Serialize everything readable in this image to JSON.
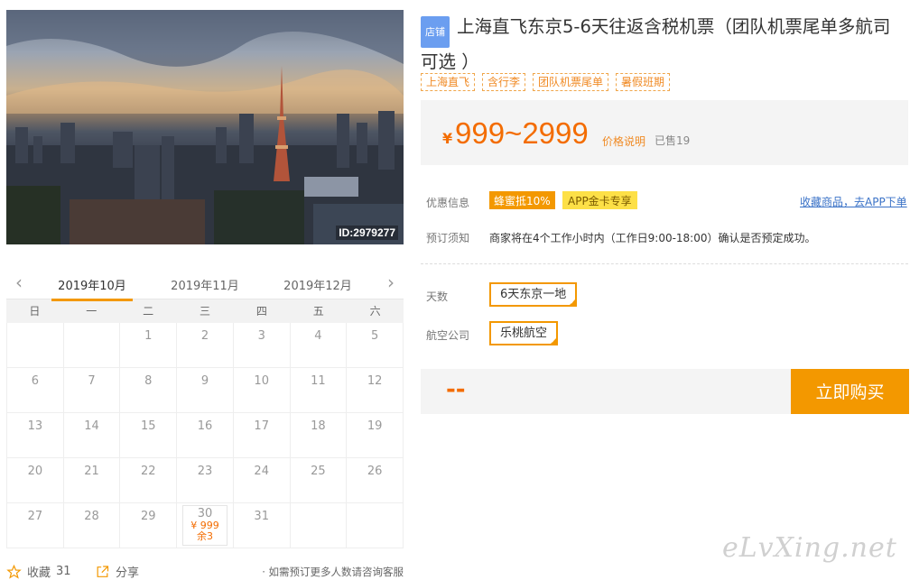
{
  "photo": {
    "id_label": "ID:2979277"
  },
  "calendar": {
    "months": [
      "2019年10月",
      "2019年11月",
      "2019年12月"
    ],
    "active_month": 0,
    "weekdays": [
      "日",
      "一",
      "二",
      "三",
      "四",
      "五",
      "六"
    ],
    "weeks": [
      [
        {
          "d": ""
        },
        {
          "d": ""
        },
        {
          "d": "1"
        },
        {
          "d": "2"
        },
        {
          "d": "3"
        },
        {
          "d": "4"
        },
        {
          "d": "5"
        }
      ],
      [
        {
          "d": "6"
        },
        {
          "d": "7"
        },
        {
          "d": "8"
        },
        {
          "d": "9"
        },
        {
          "d": "10"
        },
        {
          "d": "11"
        },
        {
          "d": "12"
        }
      ],
      [
        {
          "d": "13"
        },
        {
          "d": "14"
        },
        {
          "d": "15"
        },
        {
          "d": "16"
        },
        {
          "d": "17"
        },
        {
          "d": "18"
        },
        {
          "d": "19"
        }
      ],
      [
        {
          "d": "20"
        },
        {
          "d": "21"
        },
        {
          "d": "22"
        },
        {
          "d": "23"
        },
        {
          "d": "24"
        },
        {
          "d": "25"
        },
        {
          "d": "26"
        }
      ],
      [
        {
          "d": "27"
        },
        {
          "d": "28"
        },
        {
          "d": "29"
        },
        {
          "d": "30",
          "price": "¥ 999",
          "stock": "余3"
        },
        {
          "d": "31"
        },
        {
          "d": ""
        },
        {
          "d": ""
        }
      ]
    ]
  },
  "footer": {
    "favorite_label": "收藏",
    "favorite_count": "31",
    "share_label": "分享",
    "note": "· 如需预订更多人数请咨询客服"
  },
  "product": {
    "badge": "店铺",
    "title": "上海直飞东京5-6天往返含税机票（团队机票尾单多航司可选 ）",
    "tags": [
      "上海直飞",
      "含行李",
      "团队机票尾单",
      "暑假班期"
    ],
    "price": {
      "currency": "¥",
      "amount": "999~2999",
      "explain": "价格说明",
      "sold": "已售19"
    },
    "promo": {
      "label": "优惠信息",
      "badge1": "蜂蜜抵10%",
      "badge2": "APP金卡专享",
      "link": "收藏商品，去APP下单"
    },
    "notice": {
      "label": "预订须知",
      "text": "商家将在4个工作小时内（工作日9:00-18:00）确认是否预定成功。"
    },
    "options": {
      "days_label": "天数",
      "days_value": "6天东京一地",
      "airline_label": "航空公司",
      "airline_value": "乐桃航空"
    },
    "buy": {
      "total": "--",
      "button": "立即购买"
    }
  },
  "watermark": "eLvXing.net",
  "colors": {
    "accent": "#f39800",
    "price": "#f36c00",
    "link": "#3a72c7",
    "badge_blue": "#6b9ef0"
  }
}
